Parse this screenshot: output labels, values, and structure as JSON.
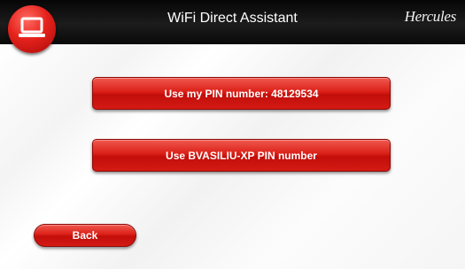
{
  "window": {
    "title": "WiFi Direct Assistant",
    "brand": "Hercules"
  },
  "icons": {
    "app_logo": "laptop-icon"
  },
  "main": {
    "pin_button_label": "Use my PIN number: 48129534",
    "other_pin_button_label": "Use BVASILIU-XP PIN number",
    "back_button_label": "Back"
  },
  "colors": {
    "accent": "#d8211a",
    "title_bar": "#111111"
  }
}
